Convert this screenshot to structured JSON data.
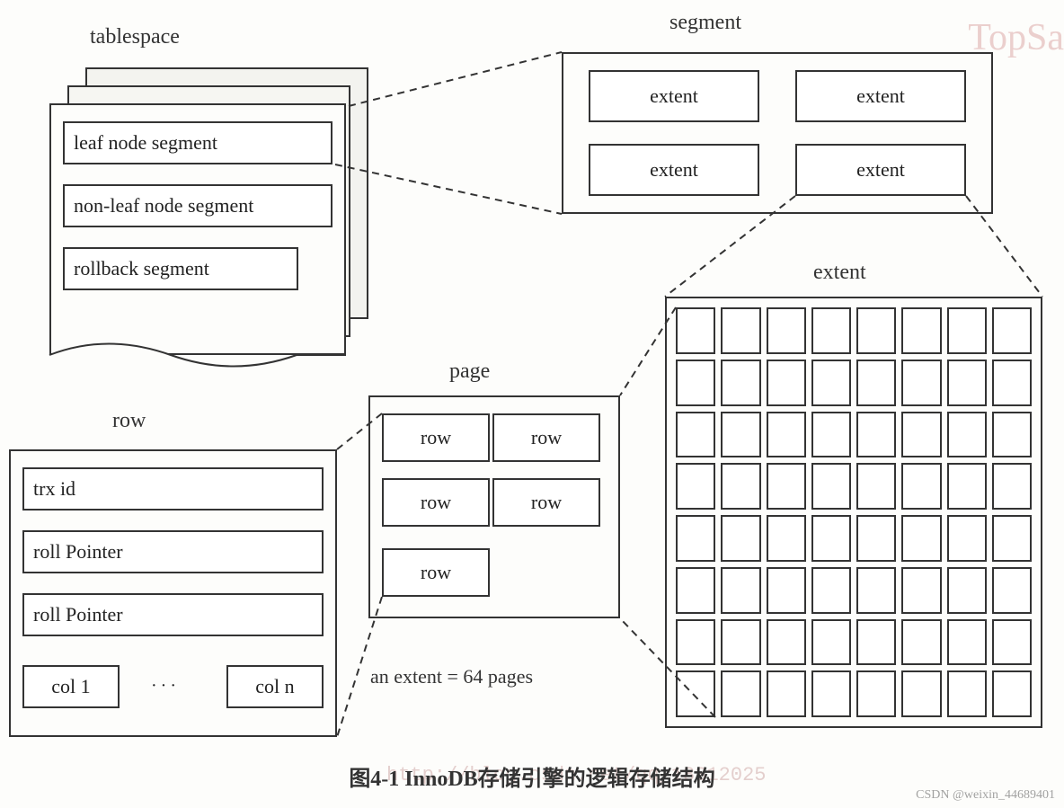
{
  "labels": {
    "tablespace": "tablespace",
    "segment": "segment",
    "extent": "extent",
    "page": "page",
    "row": "row"
  },
  "tablespace": {
    "items": [
      "leaf node segment",
      "non-leaf node segment",
      "rollback segment"
    ]
  },
  "segment": {
    "items": [
      "extent",
      "extent",
      "extent",
      "extent"
    ]
  },
  "extent": {
    "note": "an extent = 64 pages",
    "grid_cols": 8,
    "grid_rows": 8
  },
  "page": {
    "rows": [
      "row",
      "row",
      "row",
      "row",
      "row"
    ]
  },
  "row": {
    "fields": [
      "trx id",
      "roll Pointer",
      "roll Pointer"
    ],
    "cols": [
      "col  1",
      "col  n"
    ],
    "ellipsis": "···"
  },
  "caption": "图4-1  InnoDB存储引擎的逻辑存储结构",
  "watermarks": {
    "top": "TopSa",
    "mid": "http://blog.csdn.net/qq_18312025",
    "bot": "CSDN @weixin_44689401"
  }
}
